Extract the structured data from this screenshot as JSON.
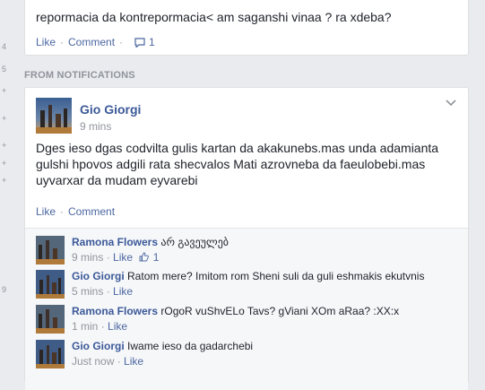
{
  "left_rail": [
    "4",
    "5",
    "+",
    "+",
    "+",
    "+",
    "+",
    "9"
  ],
  "top_post": {
    "text": "repormacia da kontrepormacia< am saganshi vinaa ? ra xdeba?",
    "like_label": "Like",
    "comment_label": "Comment",
    "comment_count": "1"
  },
  "section_heading": "FROM NOTIFICATIONS",
  "post": {
    "author": "Gio Giorgi",
    "time": "9 mins",
    "body": "Dges ieso dgas codvilta gulis kartan da akakunebs.mas unda adamianta gulshi hpovos adgili rata shecvalos Mati azrovneba da faeulobebi.mas uyvarxar da mudam eyvarebi",
    "like_label": "Like",
    "comment_label": "Comment"
  },
  "comments": [
    {
      "author": "Ramona Flowers",
      "text": "არ გავეულებ",
      "time": "9 mins",
      "like_label": "Like",
      "likes": "1"
    },
    {
      "author": "Gio Giorgi",
      "text": "Ratom mere? Imitom rom Sheni suli da guli eshmakis ekutvnis",
      "time": "5 mins",
      "like_label": "Like"
    },
    {
      "author": "Ramona Flowers",
      "text": "rOgoR vuShvELo Tavs? gViani XOm aRaa? :XX:x",
      "time": "1 min",
      "like_label": "Like"
    },
    {
      "author": "Gio Giorgi",
      "text": "Iwame ieso da gadarchebi",
      "time": "Just now",
      "like_label": "Like"
    }
  ],
  "colors": {
    "link": "#3b5998",
    "action": "#4b67a1",
    "muted": "#90949c",
    "page_bg": "#e9ebee"
  }
}
